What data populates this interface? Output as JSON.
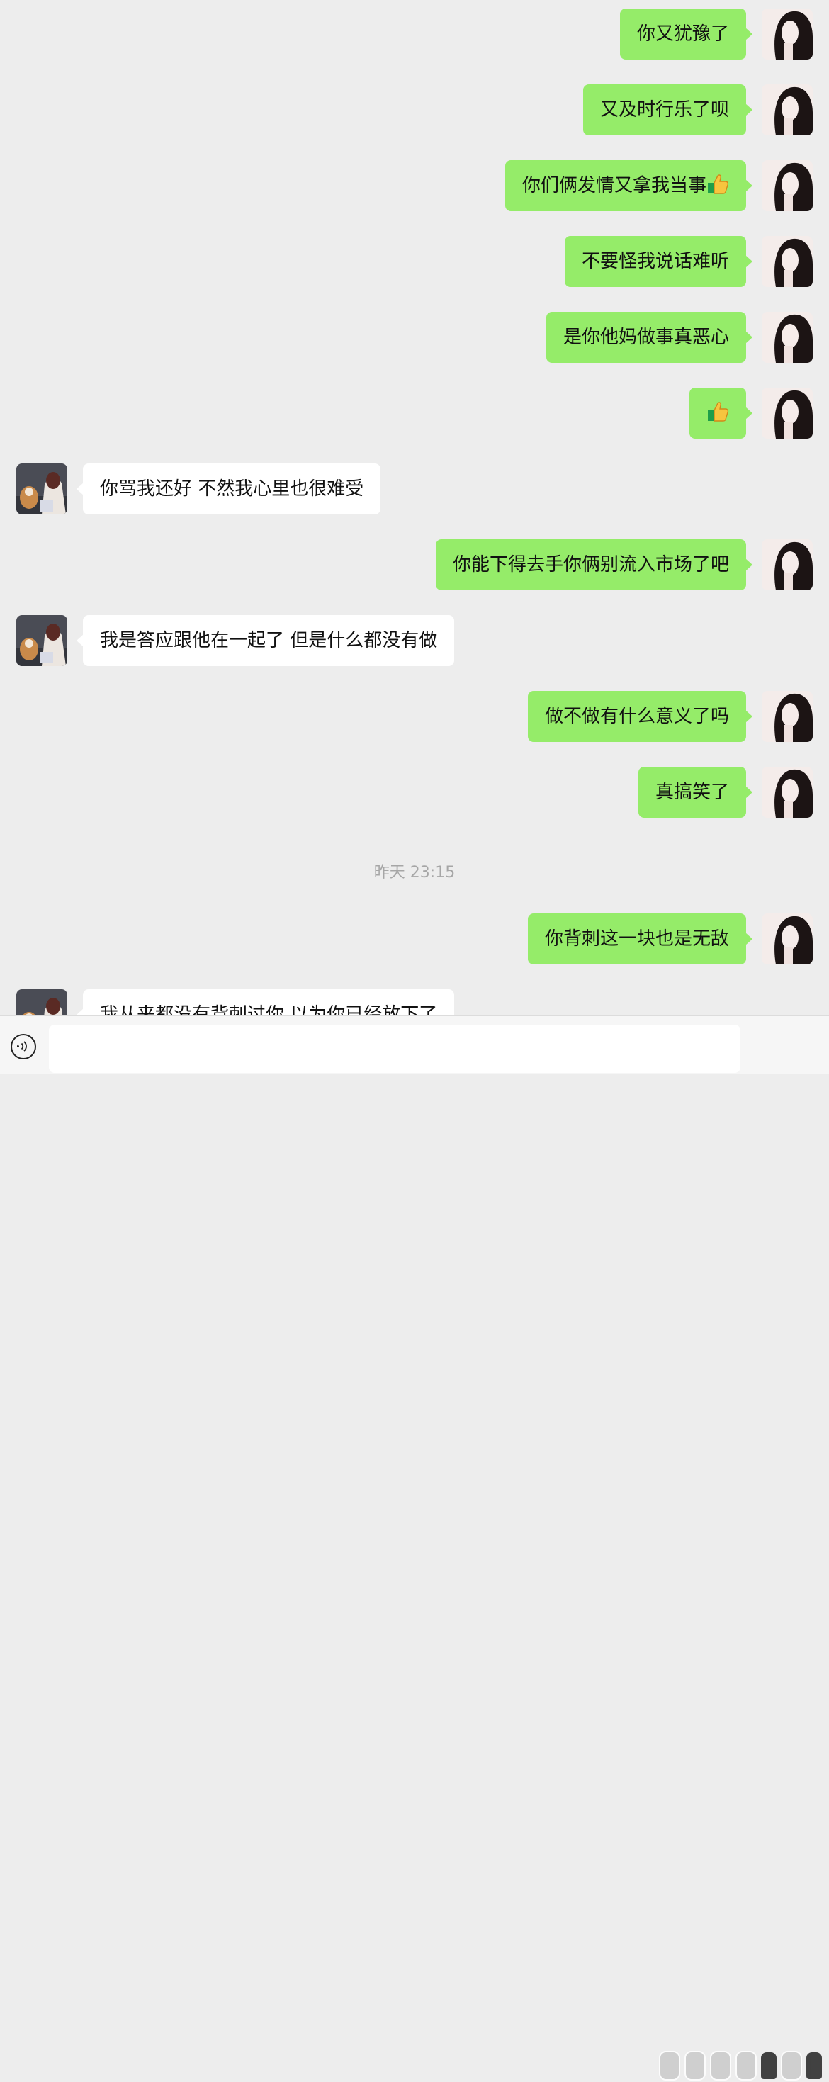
{
  "chat": {
    "messages": [
      {
        "sender": "me",
        "text": "你又犹豫了"
      },
      {
        "sender": "me",
        "text": "又及时行乐了呗"
      },
      {
        "sender": "me",
        "text": "你们俩发情又拿我当事",
        "emoji": "thumbs-up-icon"
      },
      {
        "sender": "me",
        "text": "不要怪我说话难听"
      },
      {
        "sender": "me",
        "text": "是你他妈做事真恶心"
      },
      {
        "sender": "me",
        "text": "",
        "emoji": "thumbs-up-icon"
      },
      {
        "sender": "other",
        "text": "你骂我还好  不然我心里也很难受"
      },
      {
        "sender": "me",
        "text": "你能下得去手你俩别流入市场了吧"
      },
      {
        "sender": "other",
        "text": "我是答应跟他在一起了  但是什么都没有做"
      },
      {
        "sender": "me",
        "text": "做不做有什么意义了吗"
      },
      {
        "sender": "me",
        "text": "真搞笑了"
      },
      {
        "sender": "me",
        "text": "你背刺这一块也是无敌"
      },
      {
        "sender": "other",
        "text": "我从来都没有背刺过你  以为你已经放下了"
      }
    ],
    "timestamp": "昨天 23:15"
  },
  "input_bar": {
    "voice_icon": "voice-mode-icon",
    "input_value": "",
    "watermark_icon": "watermark-logo-icon"
  },
  "colors": {
    "background": "#ededed",
    "sent_bubble": "#95ec69",
    "received_bubble": "#ffffff",
    "timestamp_text": "#a6a6a6"
  }
}
